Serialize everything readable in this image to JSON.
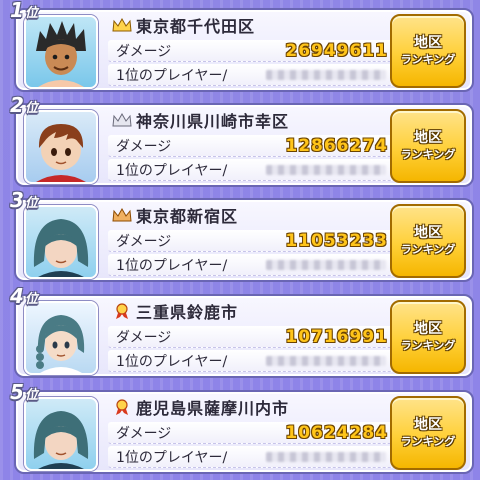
{
  "rankings": [
    {
      "rank": "1",
      "rank_suffix": "位",
      "region": "東京都千代田区",
      "badge": "crown-icon",
      "damage_label": "ダメージ",
      "damage": "26949611",
      "player_label": "1位のプレイヤー/",
      "button_line1": "地区",
      "button_line2": "ランキング",
      "avatar": "spiky-hair-boy"
    },
    {
      "rank": "2",
      "rank_suffix": "位",
      "region": "神奈川県川崎市幸区",
      "badge": "crown-icon",
      "damage_label": "ダメージ",
      "damage": "12866274",
      "player_label": "1位のプレイヤー/",
      "button_line1": "地区",
      "button_line2": "ランキング",
      "avatar": "brown-hair-boy"
    },
    {
      "rank": "3",
      "rank_suffix": "位",
      "region": "東京都新宿区",
      "badge": "crown-icon",
      "damage_label": "ダメージ",
      "damage": "11053233",
      "player_label": "1位のプレイヤー/",
      "button_line1": "地区",
      "button_line2": "ランキング",
      "avatar": "teal-hair-boy"
    },
    {
      "rank": "4",
      "rank_suffix": "位",
      "region": "三重県鈴鹿市",
      "badge": "ribbon-icon",
      "damage_label": "ダメージ",
      "damage": "10716991",
      "player_label": "1位のプレイヤー/",
      "button_line1": "地区",
      "button_line2": "ランキング",
      "avatar": "braid-girl"
    },
    {
      "rank": "5",
      "rank_suffix": "位",
      "region": "鹿児島県薩摩川内市",
      "badge": "ribbon-icon",
      "damage_label": "ダメージ",
      "damage": "10624284",
      "player_label": "1位のプレイヤー/",
      "button_line1": "地区",
      "button_line2": "ランキング",
      "avatar": "teal-hair-boy"
    }
  ],
  "colors": {
    "background": "#8f86e6",
    "value": "#ffc51a",
    "button": "#ffd038",
    "card_border": "#6a66b4"
  }
}
